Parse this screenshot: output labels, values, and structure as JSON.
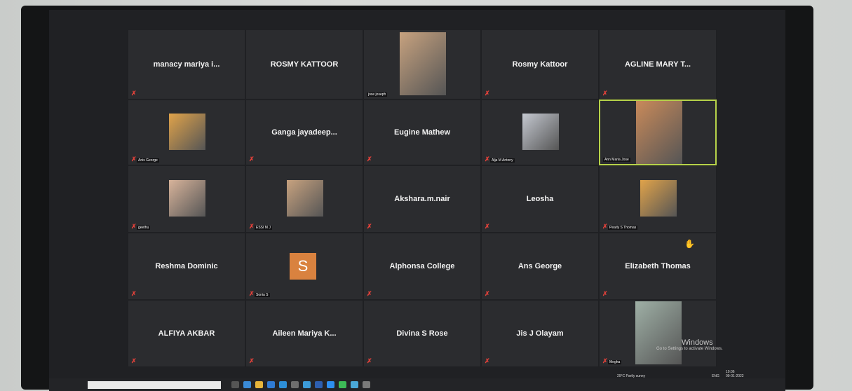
{
  "tiles": [
    {
      "name": "manacy mariya i...",
      "muted": true
    },
    {
      "name": "ROSMY KATTOOR",
      "muted": false
    },
    {
      "name": "",
      "video_label": "jose joseph",
      "muted": false
    },
    {
      "name": "Rosmy Kattoor",
      "muted": true
    },
    {
      "name": "AGLINE MARY T...",
      "muted": true
    },
    {
      "name": "",
      "video_label": "Anis George",
      "muted": true
    },
    {
      "name": "Ganga jayadeep...",
      "muted": true
    },
    {
      "name": "Eugine Mathew",
      "muted": true
    },
    {
      "name": "",
      "video_label": "Alja M Antony",
      "muted": true
    },
    {
      "name": "",
      "video_label": "Ann Maria Jose",
      "muted": false,
      "active": true
    },
    {
      "name": "",
      "video_label": "geethu",
      "muted": true
    },
    {
      "name": "",
      "video_label": "ESSI M J",
      "muted": true
    },
    {
      "name": "Akshara.m.nair",
      "muted": true
    },
    {
      "name": "Leosha",
      "muted": true
    },
    {
      "name": "",
      "video_label": "Pearly S Thomas",
      "muted": true
    },
    {
      "name": "Reshma Dominic",
      "muted": true
    },
    {
      "name": "",
      "video_label": "Sonia S",
      "muted": true,
      "avatar_letter": "S"
    },
    {
      "name": "Alphonsa College",
      "muted": true
    },
    {
      "name": "Ans George",
      "muted": true
    },
    {
      "name": "Elizabeth Thomas",
      "muted": true,
      "hand_raised": true
    },
    {
      "name": "ALFIYA AKBAR",
      "muted": true
    },
    {
      "name": "Aileen Mariya K...",
      "muted": true
    },
    {
      "name": "Divina S Rose",
      "muted": true
    },
    {
      "name": "Jis J Olayam",
      "muted": true
    },
    {
      "name": "",
      "video_label": "Megha",
      "muted": true
    }
  ],
  "watermark": {
    "line1": "Windows",
    "line2": "Go to Settings to activate Windows."
  },
  "tray": {
    "weather": "29°C  Partly sunny",
    "lang": "ENG",
    "time": "19:06",
    "date": "09-01-2022"
  },
  "colors": {
    "active_border": "#b7d34a",
    "mic_muted": "#e0413a",
    "avatar_orange": "#d9823f"
  }
}
